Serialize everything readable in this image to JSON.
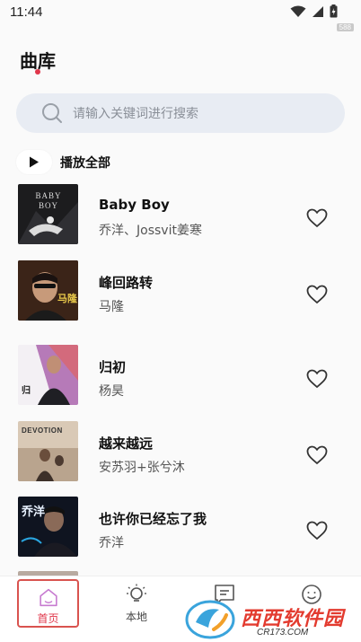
{
  "status_bar": {
    "time": "11:44",
    "tag": "588",
    "icons": [
      "wifi-icon",
      "signal-icon",
      "battery-icon"
    ]
  },
  "page": {
    "title": "曲库",
    "accent_color": "#e0364a"
  },
  "search": {
    "placeholder": "请输入关键词进行搜索",
    "icon": "search-icon"
  },
  "play_all": {
    "label": "播放全部",
    "icon": "play-icon"
  },
  "songs": [
    {
      "title": "Baby Boy",
      "artist": "乔洋、Jossvit姜寒",
      "cover_text": "BABY BOY",
      "liked": false
    },
    {
      "title": "峰回路转",
      "artist": "马隆",
      "cover_text": "马隆",
      "liked": false
    },
    {
      "title": "归初",
      "artist": "杨昊",
      "cover_text": "归",
      "liked": false
    },
    {
      "title": "越来越远",
      "artist": "安苏羽+张兮沐",
      "cover_text": "DEVOTION",
      "liked": false
    },
    {
      "title": "也许你已经忘了我",
      "artist": "乔洋",
      "cover_text": "乔洋",
      "liked": false
    }
  ],
  "bottom_nav": {
    "items": [
      {
        "label": "首页",
        "icon": "home-icon",
        "active": true
      },
      {
        "label": "本地",
        "icon": "lightbulb-icon",
        "active": false
      },
      {
        "label": "",
        "icon": "notes-icon",
        "active": false
      },
      {
        "label": "",
        "icon": "smiley-icon",
        "active": false
      }
    ]
  },
  "watermark": {
    "text": "西西软件园",
    "url": "CR173.COM"
  }
}
